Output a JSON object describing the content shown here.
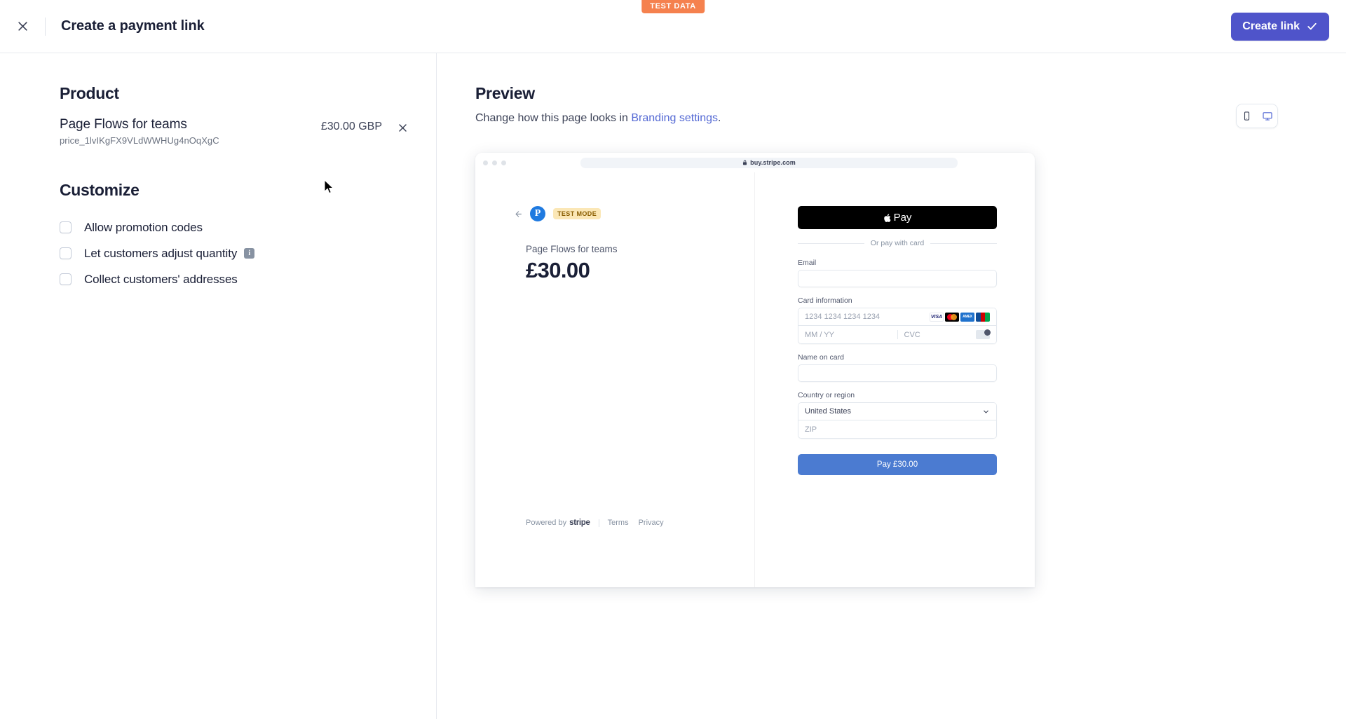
{
  "test_data_ribbon": "TEST DATA",
  "topbar": {
    "close_icon": "close-icon",
    "title": "Create a payment link",
    "create_button_label": "Create link",
    "create_button_icon": "check-icon",
    "accent_color": "#4f54ca"
  },
  "left": {
    "product_heading": "Product",
    "product_name": "Page Flows for teams",
    "product_price_id": "price_1lvIKgFX9VLdWWHUg4nOqXgC",
    "product_price": "£30.00 GBP",
    "remove_icon": "close-icon",
    "customize_heading": "Customize",
    "options": [
      {
        "label": "Allow promotion codes",
        "checked": false,
        "info": false
      },
      {
        "label": "Let customers adjust quantity",
        "checked": false,
        "info": true,
        "info_glyph": "i"
      },
      {
        "label": "Collect customers' addresses",
        "checked": false,
        "info": false
      }
    ]
  },
  "preview": {
    "title": "Preview",
    "subtitle_prefix": "Change how this page looks in ",
    "subtitle_link": "Branding settings",
    "subtitle_suffix": ".",
    "link_color": "#5469d4",
    "device_toggle": {
      "mobile_icon": "mobile-icon",
      "desktop_icon": "desktop-icon",
      "active": "desktop"
    }
  },
  "browser": {
    "url": "buy.stripe.com",
    "lock_icon": "lock-icon"
  },
  "checkout": {
    "back_icon": "back-arrow-icon",
    "merchant_logo_letter": "P",
    "test_mode_badge": "TEST MODE",
    "product_name": "Page Flows for teams",
    "amount": "£30.00",
    "footer": {
      "powered_by": "Powered by",
      "stripe": "stripe",
      "terms": "Terms",
      "privacy": "Privacy"
    },
    "apple_pay_label": "Pay",
    "apple_pay_icon": "apple-icon",
    "or_pay_with_card": "Or pay with card",
    "fields": {
      "email_label": "Email",
      "email_value": "",
      "card_label": "Card information",
      "card_number_placeholder": "1234 1234 1234 1234",
      "card_expiry_placeholder": "MM / YY",
      "card_cvc_placeholder": "CVC",
      "name_label": "Name on card",
      "name_value": "",
      "country_label": "Country or region",
      "country_value": "United States",
      "zip_placeholder": "ZIP"
    },
    "card_brands": [
      "visa",
      "mastercard",
      "amex",
      "jcb"
    ],
    "pay_button_label": "Pay £30.00",
    "pay_button_color": "#4b7bd1"
  }
}
